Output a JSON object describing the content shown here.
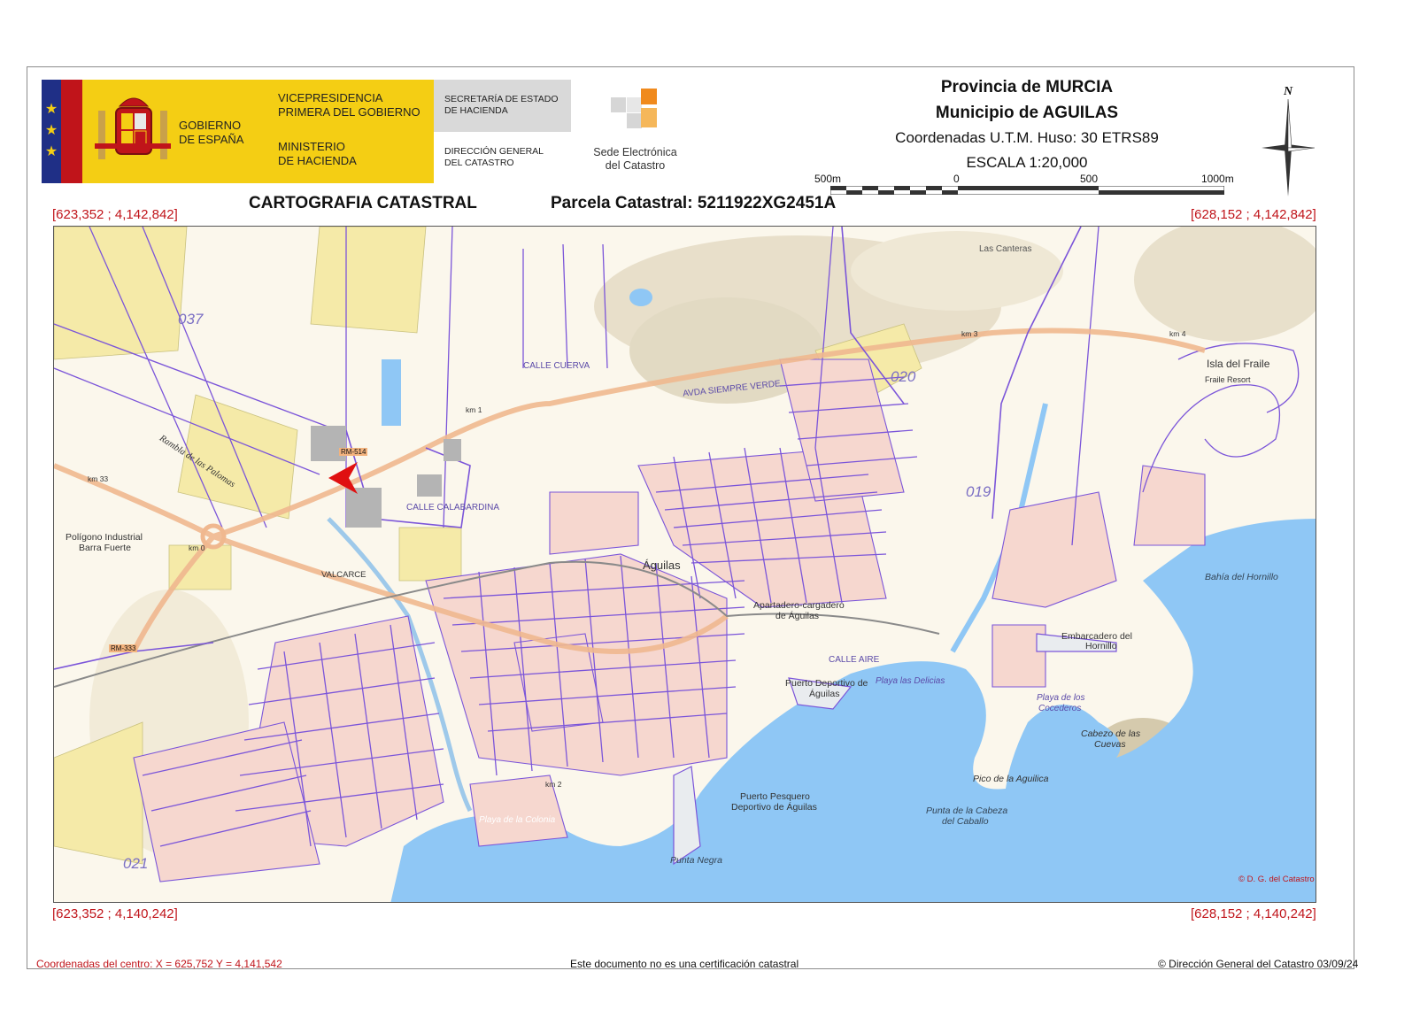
{
  "header": {
    "gov_line1": "GOBIERNO",
    "gov_line2": "DE ESPAÑA",
    "vice_line1": "VICEPRESIDENCIA",
    "vice_line2": "PRIMERA DEL GOBIERNO",
    "ministry_line1": "MINISTERIO",
    "ministry_line2": "DE HACIENDA",
    "secretary_line1": "SECRETARÍA DE ESTADO",
    "secretary_line2": "DE HACIENDA",
    "direction_line1": "DIRECCIÓN GENERAL",
    "direction_line2": "DEL CATASTRO",
    "sede_line1": "Sede Electrónica",
    "sede_line2": "del Catastro",
    "province": "Provincia de MURCIA",
    "municipality": "Municipio de AGUILAS",
    "coordinates_system": "Coordenadas U.T.M. Huso: 30 ETRS89",
    "scale": "ESCALA 1:20,000",
    "north": "N"
  },
  "scale_bar": {
    "label_left": "500m",
    "label_zero": "0",
    "label_mid": "500",
    "label_right": "1000m"
  },
  "titles": {
    "cartography": "CARTOGRAFIA CATASTRAL",
    "parcel": "Parcela Catastral: 5211922XG2451A"
  },
  "corners": {
    "top_left": "[623,352 ; 4,142,842]",
    "top_right": "[628,152 ; 4,142,842]",
    "bottom_left": "[623,352 ; 4,140,242]",
    "bottom_right": "[628,152 ; 4,140,242]"
  },
  "map_labels": {
    "zone_037": "037",
    "zone_020": "020",
    "zone_019": "019",
    "zone_021": "021",
    "las_canteras": "Las Canteras",
    "isla_fraile": "Isla del Fraile",
    "fraile_resort": "Fraile Resort",
    "bahia_hornillo": "Bahía del Hornillo",
    "rambla": "Rambla de las Palomas",
    "poligono": "Polígono Industrial",
    "barra_fuerte": "Barra Fuerte",
    "valcarce": "VALCARCE",
    "aguilas": "Águilas",
    "apartadero": "Apartadero-cargadero",
    "apartadero2": "de Águilas",
    "puerto_deportivo": "Puerto Deportivo de",
    "puerto_deportivo2": "Águilas",
    "playa_delicias": "Playa las Delicias",
    "embarcadero": "Embarcadero del",
    "embarcadero2": "Hornillo",
    "playa_cocederos": "Playa de los",
    "playa_cocederos2": "Cocederos",
    "cabezo_cuevas": "Cabezo de las",
    "cabezo_cuevas2": "Cuevas",
    "pico_aguilica": "Pico de la Aguilica",
    "punta_cabeza": "Punta de la Cabeza",
    "punta_cabeza2": "del Caballo",
    "puerto_pesquero": "Puerto Pesquero",
    "puerto_pesquero2": "Deportivo de Águilas",
    "punta_negra": "Punta Negra",
    "playa_colonia": "Playa de la Colonia",
    "rm514": "RM-514",
    "rm333": "RM-333",
    "km33": "km 33",
    "km0": "km 0",
    "km1": "km 1",
    "km2": "km 2",
    "km3": "km 3",
    "km4": "km 4",
    "calle_cuerva": "CALLE CUERVA",
    "avda_siempre_verde": "AVDA SIEMPRE VERDE",
    "calle_calabardina": "CALLE CALABARDINA",
    "calle_aire": "CALLE AIRE",
    "copyright_map": "© D. G. del Catastro"
  },
  "footer": {
    "center_coords": "Coordenadas del centro: X = 625,752 Y = 4,141,542",
    "disclaimer": "Este documento no es una certificación catastral",
    "copyright": "© Dirección General del Catastro 03/09/24"
  },
  "colors": {
    "gov_yellow": "#f4ce14",
    "flag_blue": "#1f2f86",
    "flag_red": "#c0141a",
    "sea": "#8fc7f5",
    "parcel_line": "#7b55d9",
    "marker": "#e01010"
  }
}
